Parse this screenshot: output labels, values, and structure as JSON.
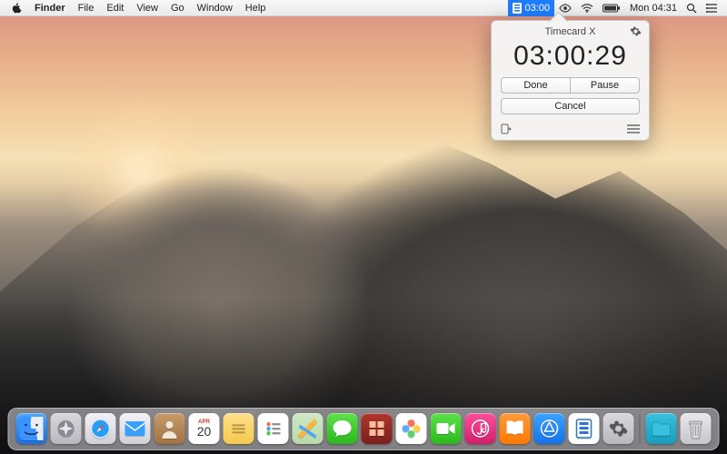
{
  "menubar": {
    "app_name": "Finder",
    "items": [
      "File",
      "Edit",
      "View",
      "Go",
      "Window",
      "Help"
    ],
    "status": {
      "timecard_menu": "03:00",
      "clock": "Mon 04:31"
    }
  },
  "popover": {
    "title": "Timecard X",
    "timer": "03:00:29",
    "done_label": "Done",
    "pause_label": "Pause",
    "cancel_label": "Cancel"
  },
  "dock": {
    "calendar": {
      "month": "APR",
      "day": "20"
    },
    "apps": [
      {
        "id": "finder",
        "name": "Finder"
      },
      {
        "id": "launchpad",
        "name": "Launchpad"
      },
      {
        "id": "safari",
        "name": "Safari"
      },
      {
        "id": "mail",
        "name": "Mail"
      },
      {
        "id": "contacts",
        "name": "Contacts"
      },
      {
        "id": "calendar",
        "name": "Calendar"
      },
      {
        "id": "notes",
        "name": "Notes"
      },
      {
        "id": "reminders",
        "name": "Reminders"
      },
      {
        "id": "maps",
        "name": "Maps"
      },
      {
        "id": "messages",
        "name": "Messages"
      },
      {
        "id": "photobooth",
        "name": "Photo Booth"
      },
      {
        "id": "photos",
        "name": "Photos"
      },
      {
        "id": "facetime",
        "name": "FaceTime"
      },
      {
        "id": "itunes",
        "name": "iTunes"
      },
      {
        "id": "ibooks",
        "name": "iBooks"
      },
      {
        "id": "appstore",
        "name": "App Store"
      },
      {
        "id": "timecard",
        "name": "Timecard"
      },
      {
        "id": "prefs",
        "name": "System Preferences"
      }
    ],
    "right": [
      {
        "id": "downloads",
        "name": "Downloads"
      },
      {
        "id": "trash",
        "name": "Trash"
      }
    ]
  }
}
